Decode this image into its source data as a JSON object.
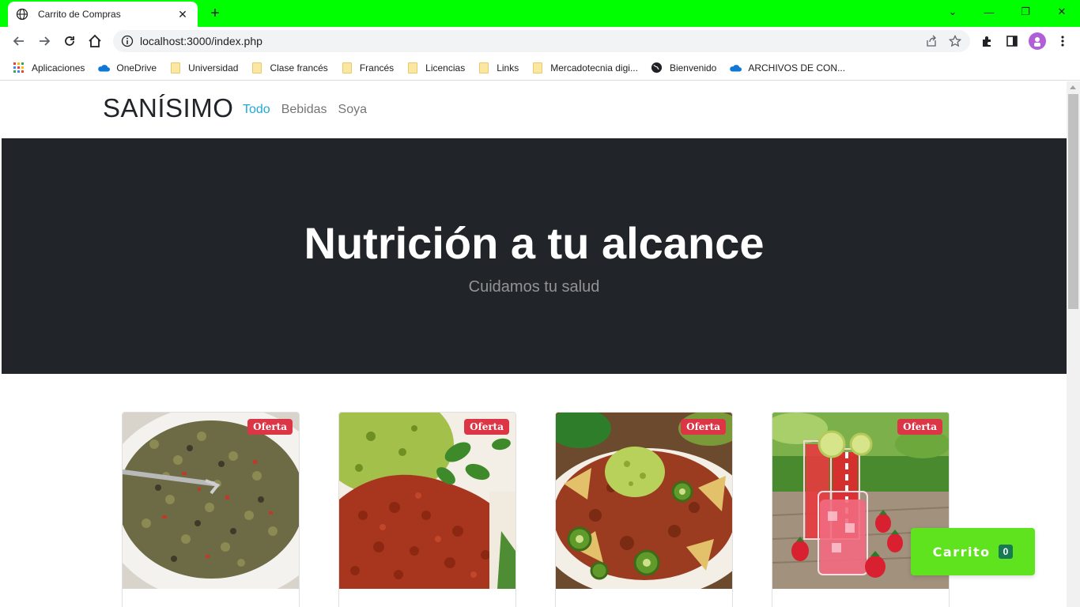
{
  "browser": {
    "tab_title": "Carrito de Compras",
    "tab_close": "✕",
    "new_tab": "+",
    "url": "localhost:3000/index.php",
    "window_controls": {
      "dropdown": "⌄",
      "minimize": "—",
      "restore": "❐",
      "close": "✕"
    },
    "bookmarks": [
      {
        "label": "Aplicaciones",
        "icon": "apps-grid-icon"
      },
      {
        "label": "OneDrive",
        "icon": "cloud-icon"
      },
      {
        "label": "Universidad",
        "icon": "folder-icon"
      },
      {
        "label": "Clase francés",
        "icon": "folder-icon"
      },
      {
        "label": "Francés",
        "icon": "folder-icon"
      },
      {
        "label": "Licencias",
        "icon": "folder-icon"
      },
      {
        "label": "Links",
        "icon": "folder-icon"
      },
      {
        "label": "Mercadotecnia digi...",
        "icon": "folder-icon"
      },
      {
        "label": "Bienvenido",
        "icon": "globe-icon"
      },
      {
        "label": "ARCHIVOS DE CON...",
        "icon": "cloud-icon"
      }
    ],
    "accent_color": "#00ff00"
  },
  "site": {
    "brand": "SANÍSIMO",
    "nav": [
      {
        "label": "Todo",
        "active": true
      },
      {
        "label": "Bebidas",
        "active": false
      },
      {
        "label": "Soya",
        "active": false
      }
    ],
    "hero": {
      "title": "Nutrición a tu alcance",
      "subtitle": "Cuidamos tu salud"
    },
    "products": [
      {
        "badge": "Oferta",
        "image": "lentil-salad-bowl"
      },
      {
        "badge": "Oferta",
        "image": "soy-chorizo-guacamole"
      },
      {
        "badge": "Oferta",
        "image": "nachos-jalapeno-guacamole"
      },
      {
        "badge": "Oferta",
        "image": "strawberry-drinks"
      }
    ],
    "cart": {
      "label": "Carrito",
      "count": "0"
    },
    "colors": {
      "hero_bg": "#212529",
      "active_link": "#20a8d8",
      "badge_bg": "#dc3545",
      "cart_bg": "#5fe31e",
      "cart_count_bg": "#177a55"
    }
  }
}
